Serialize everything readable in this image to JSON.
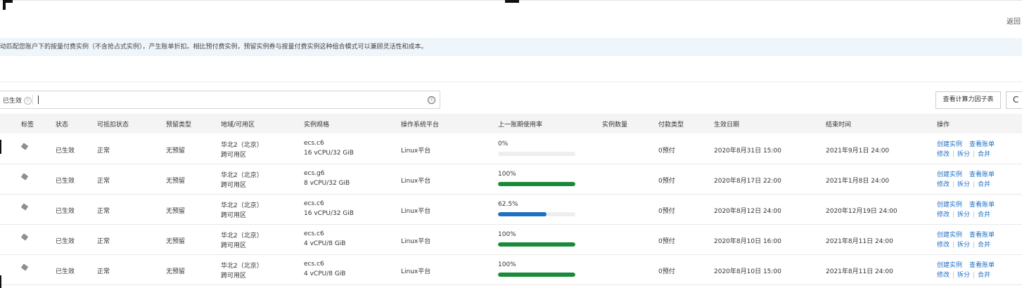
{
  "header": {
    "back_label": "返回",
    "notice": "动匹配您账户下的按量付费实例（不含抢占式实例），产生账单折扣。相比预付费实例，预留实例券与按量付费实例这种组合模式可以兼顾灵活性和成本。"
  },
  "filter": {
    "tag_label": "已生效",
    "tag_close_icon": "ⓧ",
    "input_value": "",
    "clear_icon": "ⓧ"
  },
  "toolbar": {
    "factor_button": "查看计算力因子表",
    "refresh_icon": "C"
  },
  "table": {
    "headers": [
      "标签",
      "状态",
      "可抵扣状态",
      "预留类型",
      "地域/可用区",
      "实例规格",
      "操作系统平台",
      "上一账期使用率",
      "实例数量",
      "付款类型",
      "生效日期",
      "结束时间",
      "操作"
    ],
    "rows": [
      {
        "status": "已生效",
        "deduct": "正常",
        "reserve": "无预留",
        "region": "华北2（北京）",
        "zone": "跨可用区",
        "spec": "ecs.c6",
        "spec_detail": "16 vCPU/32 GiB",
        "os": "Linux平台",
        "usage_label": "0%",
        "usage": 0,
        "bar_color": "#1a8a3a",
        "count": "",
        "payment": "0预付",
        "start": "2020年8月31日 15:00",
        "end": "2021年9月1日 24:00",
        "op_create": "创建实例",
        "op_bill": "查看账单",
        "op_modify": "修改",
        "op_split": "拆分",
        "op_merge": "合并"
      },
      {
        "status": "已生效",
        "deduct": "正常",
        "reserve": "无预留",
        "region": "华北2（北京）",
        "zone": "跨可用区",
        "spec": "ecs.g6",
        "spec_detail": "8 vCPU/32 GiB",
        "os": "Linux平台",
        "usage_label": "100%",
        "usage": 100,
        "bar_color": "#1a8a3a",
        "count": "",
        "payment": "0预付",
        "start": "2020年8月17日 22:00",
        "end": "2021年1月8日 24:00",
        "op_create": "创建实例",
        "op_bill": "查看账单",
        "op_modify": "修改",
        "op_split": "拆分",
        "op_merge": "合并"
      },
      {
        "status": "已生效",
        "deduct": "正常",
        "reserve": "无预留",
        "region": "华北2（北京）",
        "zone": "跨可用区",
        "spec": "ecs.c6",
        "spec_detail": "16 vCPU/32 GiB",
        "os": "Linux平台",
        "usage_label": "62.5%",
        "usage": 62.5,
        "bar_color": "#1f6fc4",
        "count": "",
        "payment": "0预付",
        "start": "2020年8月12日 24:00",
        "end": "2020年12月19日 24:00",
        "op_create": "创建实例",
        "op_bill": "查看账单",
        "op_modify": "修改",
        "op_split": "拆分",
        "op_merge": "合并"
      },
      {
        "status": "已生效",
        "deduct": "正常",
        "reserve": "无预留",
        "region": "华北2（北京）",
        "zone": "跨可用区",
        "spec": "ecs.c6",
        "spec_detail": "4 vCPU/8 GiB",
        "os": "Linux平台",
        "usage_label": "100%",
        "usage": 100,
        "bar_color": "#1a8a3a",
        "count": "",
        "payment": "0预付",
        "start": "2020年8月10日 16:00",
        "end": "2021年8月11日 24:00",
        "op_create": "创建实例",
        "op_bill": "查看账单",
        "op_modify": "修改",
        "op_split": "拆分",
        "op_merge": "合并"
      },
      {
        "status": "已生效",
        "deduct": "正常",
        "reserve": "无预留",
        "region": "华北2（北京）",
        "zone": "跨可用区",
        "spec": "ecs.c6",
        "spec_detail": "4 vCPU/8 GiB",
        "os": "Linux平台",
        "usage_label": "100%",
        "usage": 100,
        "bar_color": "#1a8a3a",
        "count": "",
        "payment": "0预付",
        "start": "2020年8月10日 15:00",
        "end": "2021年8月11日 24:00",
        "op_create": "创建实例",
        "op_bill": "查看账单",
        "op_modify": "修改",
        "op_split": "拆分",
        "op_merge": "合并"
      }
    ]
  }
}
